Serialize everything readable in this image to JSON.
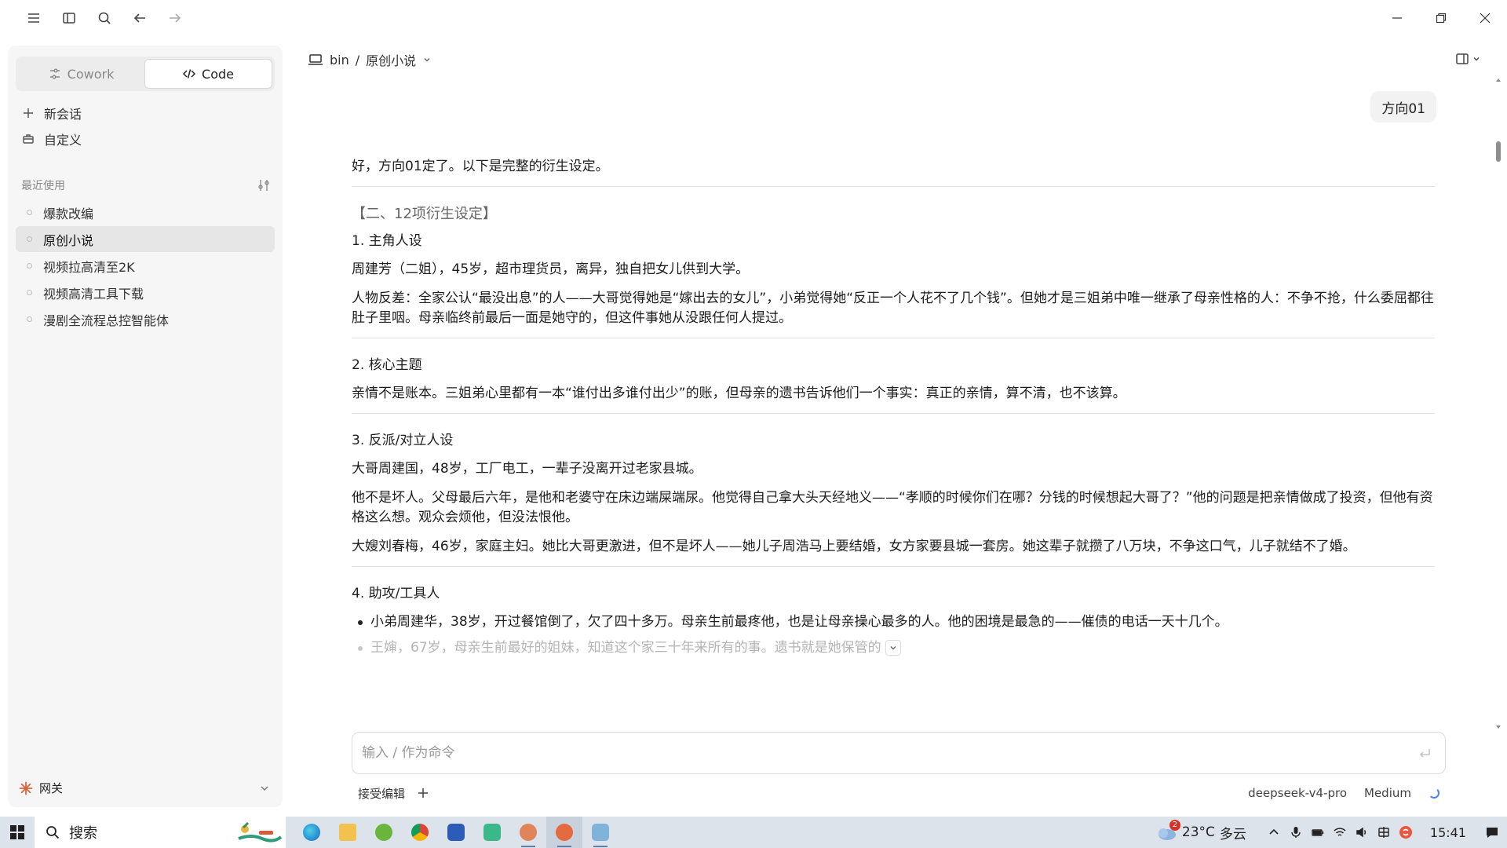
{
  "sidebar": {
    "modes": [
      {
        "label": "Cowork"
      },
      {
        "label": "Code"
      }
    ],
    "new_chat": "新会话",
    "customize": "自定义",
    "recent_title": "最近使用",
    "recent": [
      {
        "label": "爆款改编"
      },
      {
        "label": "原创小说"
      },
      {
        "label": "视频拉高清至2K"
      },
      {
        "label": "视频高清工具下载"
      },
      {
        "label": "漫剧全流程总控智能体"
      }
    ],
    "footer_label": "网关"
  },
  "header": {
    "breadcrumb_root": "bin",
    "breadcrumb_sep": "/",
    "breadcrumb_current": "原创小说"
  },
  "conversation": {
    "user_message": "方向01",
    "intro": "好，方向01定了。以下是完整的衍生设定。",
    "section_bracket": "【二、12项衍生设定】",
    "s1_title": "1. 主角人设",
    "s1_p1": "周建芳（二姐），45岁，超市理货员，离异，独自把女儿供到大学。",
    "s1_p2": "人物反差：全家公认“最没出息”的人——大哥觉得她是“嫁出去的女儿”，小弟觉得她“反正一个人花不了几个钱”。但她才是三姐弟中唯一继承了母亲性格的人：不争不抢，什么委屈都往肚子里咽。母亲临终前最后一面是她守的，但这件事她从没跟任何人提过。",
    "s2_title": "2. 核心主题",
    "s2_p1": "亲情不是账本。三姐弟心里都有一本“谁付出多谁付出少”的账，但母亲的遗书告诉他们一个事实：真正的亲情，算不清，也不该算。",
    "s3_title": "3. 反派/对立人设",
    "s3_p1": "大哥周建国，48岁，工厂电工，一辈子没离开过老家县城。",
    "s3_p2": "他不是坏人。父母最后六年，是他和老婆守在床边端屎端尿。他觉得自己拿大头天经地义——“孝顺的时候你们在哪？分钱的时候想起大哥了？”他的问题是把亲情做成了投资，但他有资格这么想。观众会烦他，但没法恨他。",
    "s3_p3": "大嫂刘春梅，46岁，家庭主妇。她比大哥更激进，但不是坏人——她儿子周浩马上要结婚，女方家要县城一套房。她这辈子就攒了八万块，不争这口气，儿子就结不了婚。",
    "s4_title": "4. 助攻/工具人",
    "s4_b1": "小弟周建华，38岁，开过餐馆倒了，欠了四十多万。母亲生前最疼他，也是让母亲操心最多的人。他的困境是最急的——催债的电话一天十几个。",
    "s4_b2": "王婶，67岁，母亲生前最好的姐妹，知道这个家三十年来所有的事。遗书就是她保管的"
  },
  "composer": {
    "placeholder": "输入 / 作为命令",
    "accept_edits": "接受编辑",
    "model": "deepseek-v4-pro",
    "effort": "Medium"
  },
  "taskbar": {
    "search_label": "搜索",
    "weather_badge": "2",
    "weather_temp": "23°C",
    "weather_desc": "多云",
    "time": "15:41"
  },
  "colors": {
    "accent_spinner": "#4a86e8",
    "footer_logo": "#d9653b",
    "badge": "#d9312a"
  }
}
